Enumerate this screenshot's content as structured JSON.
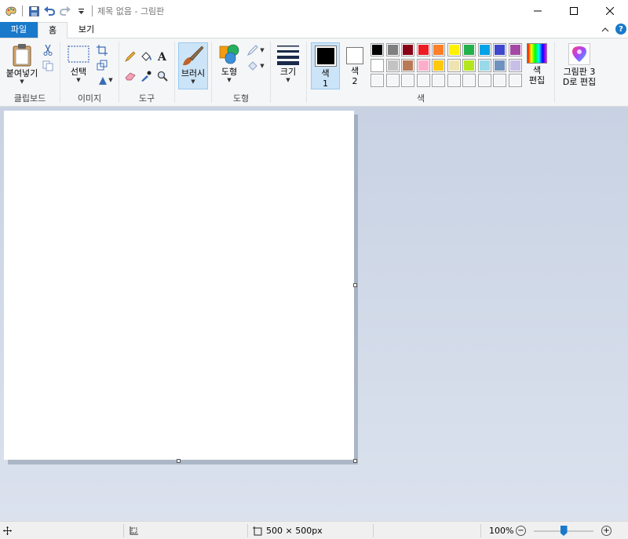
{
  "window": {
    "title": "제목 없음 - 그림판"
  },
  "tabs": {
    "file": "파일",
    "home": "홈",
    "view": "보기"
  },
  "ribbon": {
    "clipboard": {
      "label": "클립보드",
      "paste": "붙여넣기"
    },
    "image": {
      "label": "이미지",
      "select": "선택"
    },
    "tools": {
      "label": "도구"
    },
    "brushes": {
      "label": "브러시"
    },
    "shapes": {
      "label": "도형",
      "shapes_btn": "도형"
    },
    "size": {
      "label": "크기"
    },
    "colors": {
      "label": "색",
      "color1": "색\n1",
      "color2": "색\n2",
      "edit_colors": "색\n편집",
      "color1_value": "#000000",
      "color2_value": "#ffffff",
      "palette": [
        [
          "#000000",
          "#7f7f7f",
          "#880015",
          "#ed1c24",
          "#ff7f27",
          "#fff200",
          "#22b14c",
          "#00a2e8",
          "#3f48cc",
          "#a349a4"
        ],
        [
          "#ffffff",
          "#c3c3c3",
          "#b97a57",
          "#ffaec9",
          "#ffc90e",
          "#efe4b0",
          "#b5e61d",
          "#99d9ea",
          "#7092be",
          "#c8bfe7"
        ],
        [
          "#ffffff",
          "#ffffff",
          "#ffffff",
          "#ffffff",
          "#ffffff",
          "#ffffff",
          "#ffffff",
          "#ffffff",
          "#ffffff",
          "#ffffff"
        ]
      ]
    },
    "paint3d": {
      "label": "그림판 3\nD로 편집"
    }
  },
  "status": {
    "image_size": "500 × 500px",
    "zoom": "100%",
    "zoom_level": 0.5
  }
}
